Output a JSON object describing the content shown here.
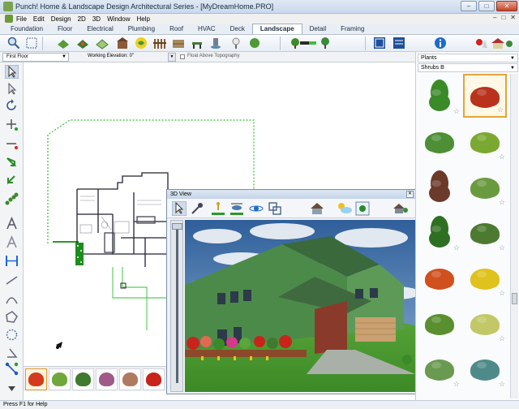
{
  "window": {
    "title": "Punch! Home & Landscape Design Architectural Series - [MyDreamHome.PRO]",
    "buttons": [
      "–",
      "□",
      "✕"
    ]
  },
  "menu": {
    "items": [
      "File",
      "Edit",
      "Design",
      "2D",
      "3D",
      "Window",
      "Help"
    ],
    "right_controls": [
      "–",
      "□",
      "✕"
    ]
  },
  "tabs": [
    {
      "label": "Foundation"
    },
    {
      "label": "Floor"
    },
    {
      "label": "Electrical"
    },
    {
      "label": "Plumbing"
    },
    {
      "label": "Roof"
    },
    {
      "label": "HVAC"
    },
    {
      "label": "Deck"
    },
    {
      "label": "Landscape"
    },
    {
      "label": "Detail"
    },
    {
      "label": "Framing"
    }
  ],
  "active_tab": "Landscape",
  "options": {
    "floor_value": "First Floor",
    "elevation_label": "Working Elevation: 0\"",
    "float_label": "Float Above Topography"
  },
  "view3d": {
    "title": "3D View",
    "close_glyph": "✕"
  },
  "sidebar": {
    "category": "Plants",
    "subcategory": "Shrubs B",
    "plant_colors": [
      "#3b8a2a",
      "#b8321c",
      "#4e8f35",
      "#7aa830",
      "#6b3a2a",
      "#6a9a40",
      "#2f6f22",
      "#4b7a30",
      "#d0501e",
      "#e0c21e",
      "#5a8f30",
      "#c2c868",
      "#6a9a50",
      "#4f8a8a"
    ],
    "selected_index": 1
  },
  "strip": {
    "plant_colors": [
      "#d43a1e",
      "#6fa83a",
      "#3f7a2e",
      "#9f5a8a",
      "#b07a60",
      "#c8241c"
    ]
  },
  "status": {
    "text": "Press F1 for Help"
  }
}
